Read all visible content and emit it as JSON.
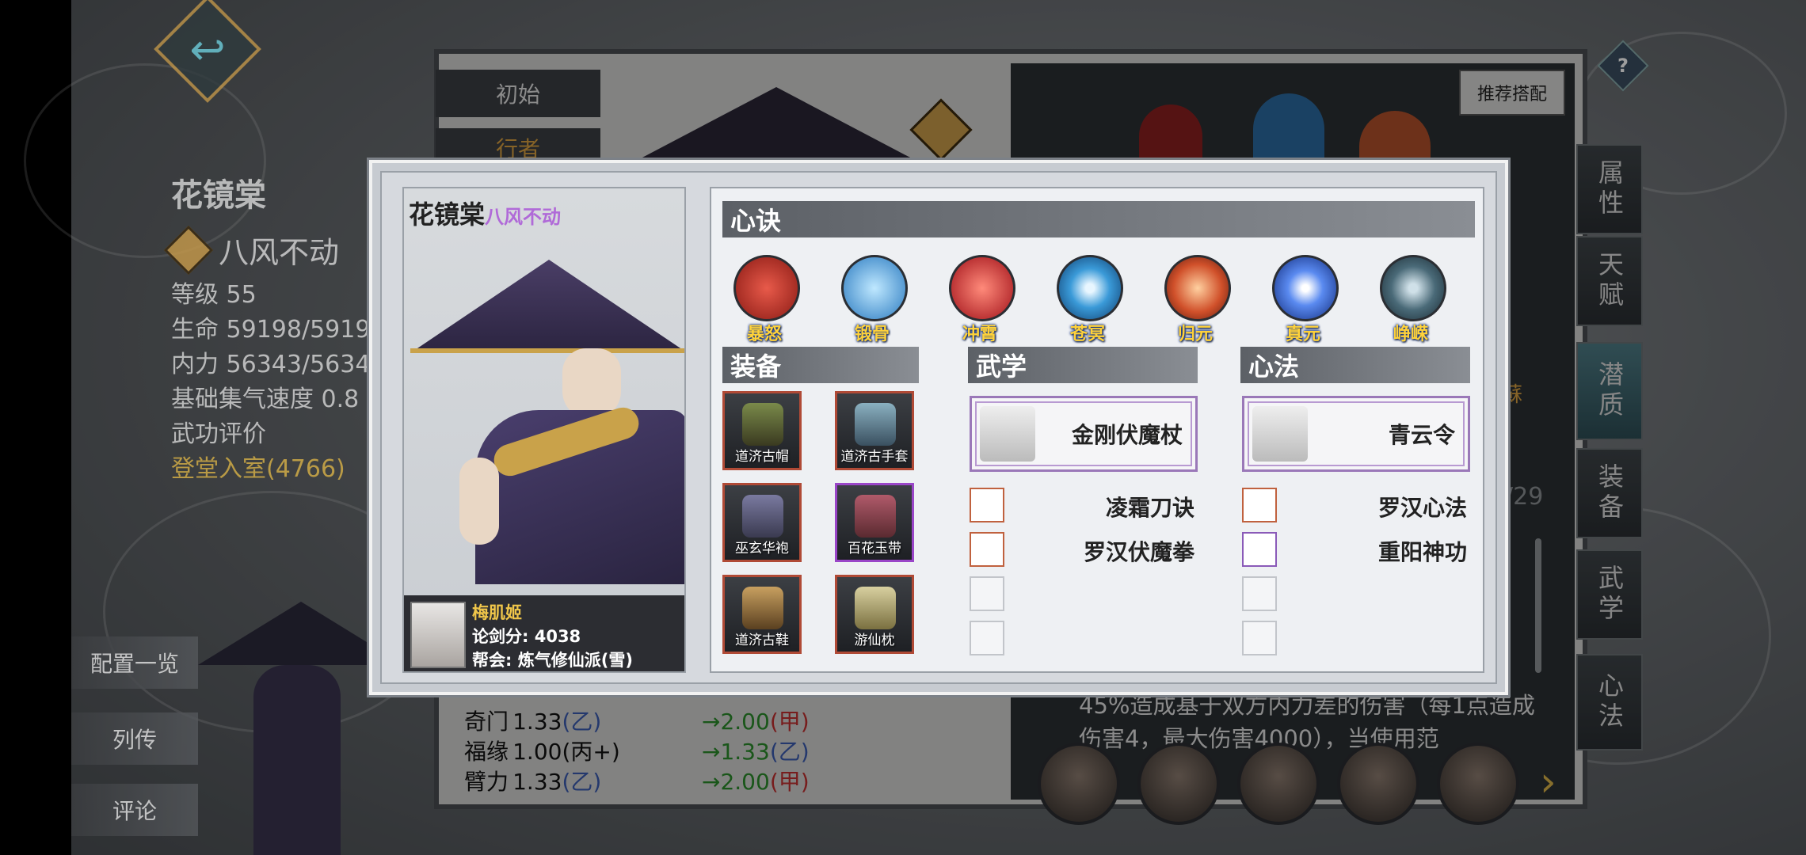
{
  "background": {
    "character": {
      "name": "花镜棠",
      "title": "八风不动",
      "stats": [
        {
          "label": "等级",
          "value": "55"
        },
        {
          "label": "生命",
          "value": "59198/5919"
        },
        {
          "label": "内力",
          "value": "56343/5634"
        },
        {
          "label": "基础集气速度",
          "value": "0.8"
        }
      ],
      "rating_label": "武功评价",
      "rating_value": "登堂入室(4766)"
    },
    "side_buttons": [
      "配置一览",
      "列传",
      "评论"
    ],
    "book_tabs": [
      "初始",
      "行者"
    ],
    "recommend_button": "推荐搭配",
    "help_icon": "?",
    "vertical_tabs": [
      "属性",
      "天赋",
      "潜质",
      "装备",
      "武学",
      "心法"
    ],
    "page_fraction": "/29",
    "partial_right_text": "蘇",
    "attributes": [
      {
        "name": "奇门",
        "value": "1.33",
        "grade": "(乙)",
        "arrow": "→",
        "new_value": "2.00",
        "new_grade": "(甲)"
      },
      {
        "name": "福缘",
        "value": "1.00",
        "grade": "(丙+)",
        "arrow": "→",
        "new_value": "1.33",
        "new_grade": "(乙)"
      },
      {
        "name": "臂力",
        "value": "1.33",
        "grade": "(乙)",
        "arrow": "→",
        "new_value": "2.00",
        "new_grade": "(甲)"
      }
    ],
    "description": "45%造成基于双方内力差的伤害（每1点造成伤害4，最大伤害4000），当使用范",
    "next_arrow": "›"
  },
  "modal": {
    "character_name": "花镜棠",
    "character_title": "八风不动",
    "owner": {
      "name": "梅肌姬",
      "score_label": "论剑分:",
      "score_value": "4038",
      "guild_label": "帮会:",
      "guild_value": "炼气修仙派(雪)"
    },
    "sections": {
      "xinjue": "心诀",
      "equipment": "装备",
      "martial": "武学",
      "xinfa": "心法"
    },
    "xinjue_items": [
      {
        "label": "暴怒",
        "color": "#c8302a"
      },
      {
        "label": "锻骨",
        "color": "#3aa0e0"
      },
      {
        "label": "冲霄",
        "color": "#d0202a"
      },
      {
        "label": "苍冥",
        "color": "#3a9ad8"
      },
      {
        "label": "归元",
        "color": "#d8602a"
      },
      {
        "label": "真元",
        "color": "#3070e0"
      },
      {
        "label": "峥嵘",
        "color": "#4a6a78"
      }
    ],
    "equipment_items": [
      {
        "label": "道济古帽",
        "rarity": "orange"
      },
      {
        "label": "道济古手套",
        "rarity": "orange"
      },
      {
        "label": "巫玄华袍",
        "rarity": "orange"
      },
      {
        "label": "百花玉带",
        "rarity": "purple"
      },
      {
        "label": "道济古鞋",
        "rarity": "orange"
      },
      {
        "label": "游仙枕",
        "rarity": "orange"
      }
    ],
    "martial": {
      "main": "金刚伏魔杖",
      "subs": [
        "凌霜刀诀",
        "罗汉伏魔拳"
      ]
    },
    "xinfa": {
      "main": "青云令",
      "subs": [
        "罗汉心法",
        "重阳神功"
      ]
    }
  }
}
